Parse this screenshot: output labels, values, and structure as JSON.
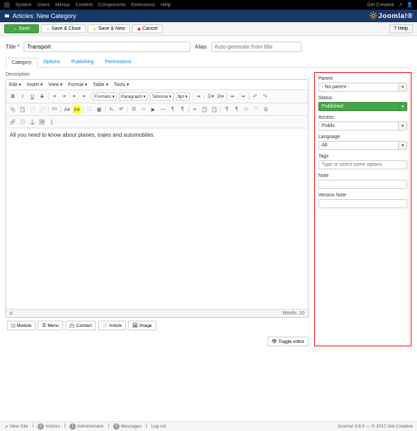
{
  "topbar": {
    "menus": [
      "System",
      "Users",
      "Menus",
      "Content",
      "Components",
      "Extensions",
      "Help"
    ],
    "right": "Get Creative"
  },
  "titlebar": {
    "title": "Articles: New Category",
    "brand": "Joomla!"
  },
  "toolbar": {
    "save": "Save",
    "save_close": "Save & Close",
    "save_new": "Save & New",
    "cancel": "Cancel",
    "help": "Help"
  },
  "form": {
    "title_label": "Title *",
    "title_value": "Transport",
    "alias_label": "Alias",
    "alias_placeholder": "Auto-generate from title"
  },
  "tabs": [
    "Category",
    "Options",
    "Publishing",
    "Permissions"
  ],
  "description_label": "Description",
  "editor": {
    "menus": [
      "Edit",
      "Insert",
      "View",
      "Format",
      "Table",
      "Tools"
    ],
    "formats_label": "Formats",
    "paragraph_label": "Paragraph",
    "font_label": "Tahoma",
    "size_label": "9pt",
    "content": "All you need to know about planes, traies and automobiles.",
    "path": "p",
    "words": "Words: 10",
    "extras": {
      "module": "Module",
      "menu": "Menu",
      "contact": "Contact",
      "article": "Article",
      "image": "Image"
    },
    "toggle": "Toggle editor"
  },
  "sidebar": {
    "parent": {
      "label": "Parent",
      "value": "- No parent -"
    },
    "status": {
      "label": "Status",
      "value": "Published"
    },
    "access": {
      "label": "Access",
      "value": "Public"
    },
    "language": {
      "label": "Language",
      "value": "All"
    },
    "tags": {
      "label": "Tags",
      "placeholder": "Type or select some options"
    },
    "note": {
      "label": "Note"
    },
    "version_note": {
      "label": "Version Note"
    }
  },
  "footer": {
    "view_site": "View Site",
    "visitors": "Visitors",
    "visitors_count": "0",
    "admin": "Administrator",
    "admin_count": "1",
    "messages": "Messages",
    "messages_count": "0",
    "logout": "Log out",
    "version": "Joomla! 3.8.0 ",
    "copyright": "— © 2017 Get Creative"
  }
}
